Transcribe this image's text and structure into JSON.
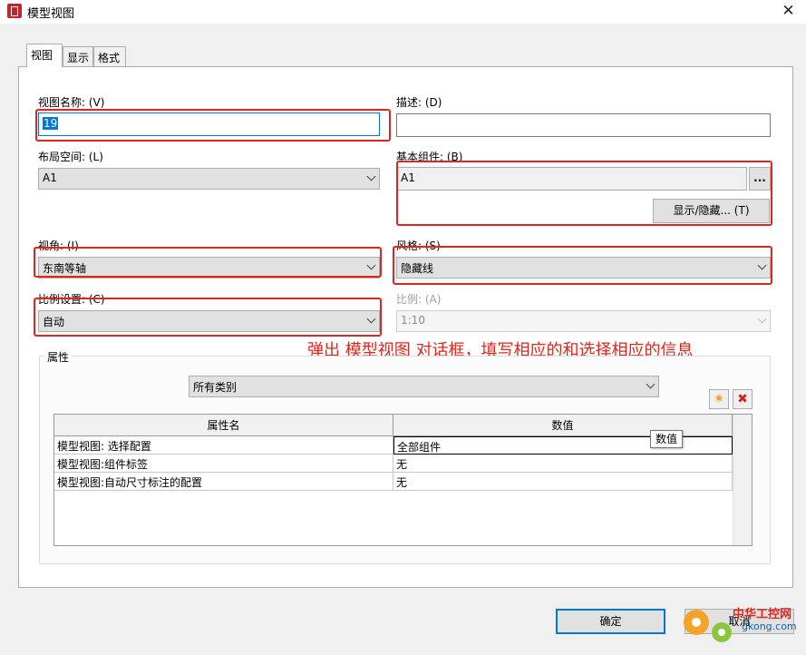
{
  "window": {
    "title": "模型视图",
    "close_symbol": "✕"
  },
  "tabs": [
    {
      "label": "视图",
      "active": true
    },
    {
      "label": "显示",
      "active": false
    },
    {
      "label": "格式",
      "active": false
    }
  ],
  "fields": {
    "view_name": {
      "label": "视图名称: (V)",
      "value": "19"
    },
    "description": {
      "label": "描述: (D)",
      "value": ""
    },
    "layout_space": {
      "label": "布局空间: (L)",
      "value": "A1"
    },
    "base_component": {
      "label": "基本组件: (B)",
      "value": "A1",
      "browse_label": "...",
      "show_hide_label": "显示/隐藏... (T)"
    },
    "view_angle": {
      "label": "视角: (I)",
      "value": "东南等轴"
    },
    "style": {
      "label": "风格: (S)",
      "value": "隐藏线"
    },
    "scale_setting": {
      "label": "比例设置: (C)",
      "value": "自动"
    },
    "scale": {
      "label": "比例: (A)",
      "value": "1:10",
      "enabled": false
    }
  },
  "annotation": {
    "text": "弹出 模型视图 对话框，填写相应的和选择相应的信息",
    "color": "#e0251c"
  },
  "properties": {
    "group_title": "属性",
    "category": "所有类别",
    "toolbar": {
      "add_icon": "sparkle-icon",
      "delete_icon": "delete-x-icon",
      "add_symbol": "✷",
      "delete_symbol": "✖"
    },
    "columns": [
      "属性名",
      "数值"
    ],
    "rows": [
      {
        "name": "模型视图: 选择配置",
        "value": "全部组件"
      },
      {
        "name": "模型视图:组件标签",
        "value": "无"
      },
      {
        "name": "模型视图:自动尺寸标注的配置",
        "value": "无"
      }
    ],
    "tooltip": "数值"
  },
  "buttons": {
    "ok": "确定",
    "cancel": "取消"
  },
  "watermark": {
    "line1": "中华工控网",
    "line2": "gkong.com"
  },
  "colors": {
    "highlight_red": "#e0251c",
    "focus_blue": "#0078d7",
    "dialog_bg": "#f0f0f0"
  }
}
